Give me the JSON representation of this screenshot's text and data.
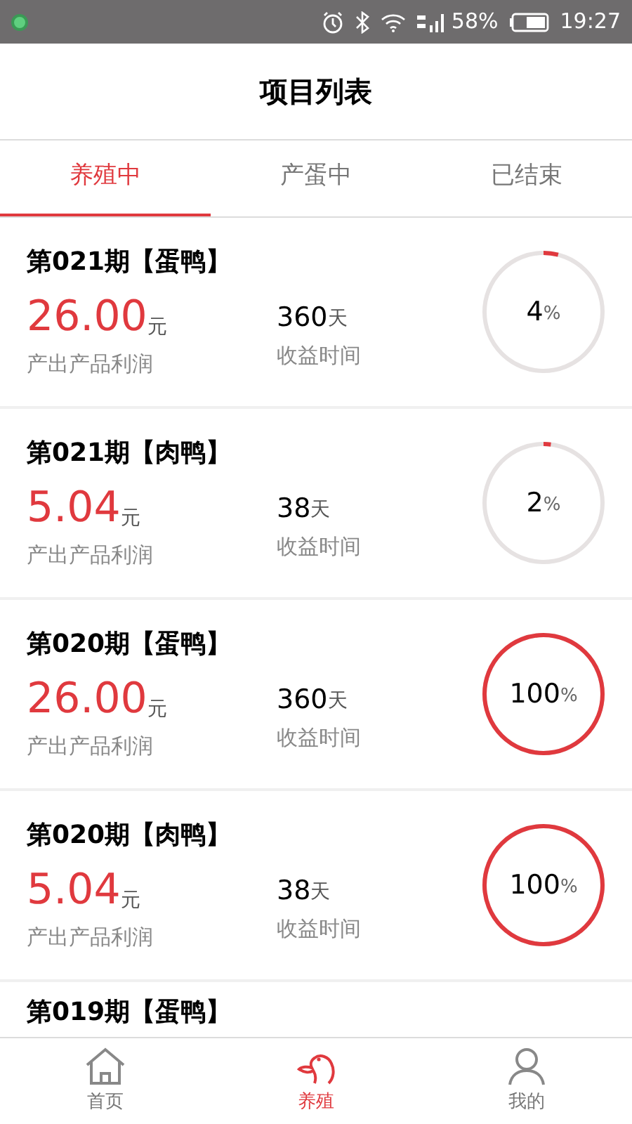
{
  "status_bar": {
    "battery": "58%",
    "time": "19:27"
  },
  "header": {
    "title": "项目列表"
  },
  "tabs": [
    {
      "label": "养殖中",
      "selected": true
    },
    {
      "label": "产蛋中",
      "selected": false
    },
    {
      "label": "已结束",
      "selected": false
    }
  ],
  "projects": [
    {
      "title": "第021期【蛋鸭】",
      "profit": "26.00",
      "profit_unit": "元",
      "profit_label": "产出产品利润",
      "period": "360",
      "period_unit": "天",
      "period_label": "收益时间",
      "level": 0.04,
      "progress": "4",
      "progress_unit": "%"
    },
    {
      "title": "第021期【肉鸭】",
      "profit": "5.04",
      "profit_unit": "元",
      "profit_label": "产出产品利润",
      "period": "38",
      "period_unit": "天",
      "period_label": "收益时间",
      "level": 0.02,
      "progress": "2",
      "progress_unit": "%"
    },
    {
      "title": "第020期【蛋鸭】",
      "profit": "26.00",
      "profit_unit": "元",
      "profit_label": "产出产品利润",
      "period": "360",
      "period_unit": "天",
      "period_label": "收益时间",
      "level": 1,
      "progress": "100",
      "progress_unit": "%"
    },
    {
      "title": "第020期【肉鸭】",
      "profit": "5.04",
      "profit_unit": "元",
      "profit_label": "产出产品利润",
      "period": "38",
      "period_unit": "天",
      "period_label": "收益时间",
      "level": 1,
      "progress": "100",
      "progress_unit": "%"
    },
    {
      "title": "第019期【蛋鸭】"
    }
  ],
  "bottom_nav": [
    {
      "kind": "home",
      "label": "首页",
      "selected": false
    },
    {
      "kind": "duck",
      "label": "养殖",
      "selected": true
    },
    {
      "kind": "user",
      "label": "我的",
      "selected": false
    }
  ]
}
